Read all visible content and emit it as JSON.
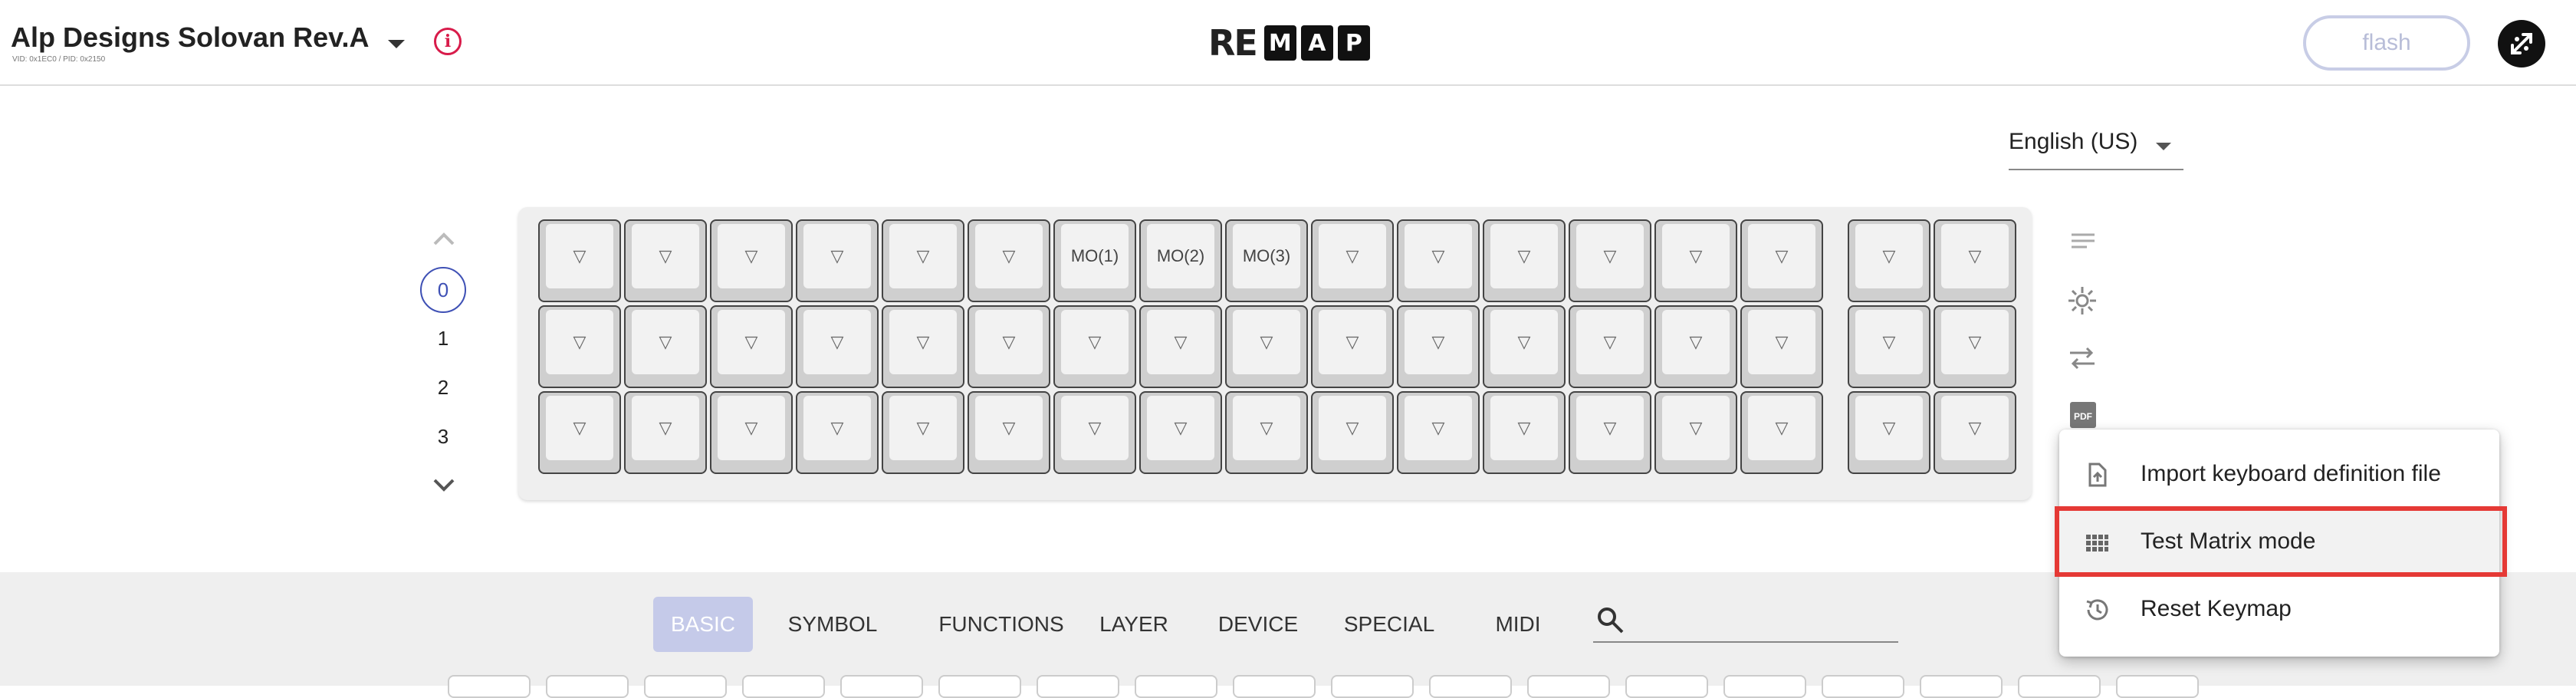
{
  "header": {
    "keyboard_name": "Alp Designs Solovan Rev.A",
    "vid_pid": "VID: 0x1EC0 / PID: 0x2150",
    "logo_prefix": "RE",
    "logo_boxes": [
      "M",
      "A",
      "P"
    ],
    "flash_label": "flash",
    "info_symbol": "i"
  },
  "language": {
    "selected": "English (US)"
  },
  "layers": {
    "items": [
      "0",
      "1",
      "2",
      "3"
    ],
    "active": "0"
  },
  "keymap": {
    "rows": [
      [
        "▽",
        "▽",
        "▽",
        "▽",
        "▽",
        "▽",
        "MO(1)",
        "MO(2)",
        "MO(3)",
        "▽",
        "▽",
        "▽",
        "▽",
        "▽",
        "▽",
        "▽",
        "▽"
      ],
      [
        "▽",
        "▽",
        "▽",
        "▽",
        "▽",
        "▽",
        "▽",
        "▽",
        "▽",
        "▽",
        "▽",
        "▽",
        "▽",
        "▽",
        "▽",
        "▽",
        "▽"
      ],
      [
        "▽",
        "▽",
        "▽",
        "▽",
        "▽",
        "▽",
        "▽",
        "▽",
        "▽",
        "▽",
        "▽",
        "▽",
        "▽",
        "▽",
        "▽",
        "▽",
        "▽"
      ]
    ]
  },
  "toolbar": {
    "icons": [
      "lines-icon",
      "brightness-icon",
      "swap-icon",
      "pdf-icon"
    ],
    "pdf_text": "PDF"
  },
  "menu": {
    "items": [
      {
        "label": "Import keyboard definition file",
        "icon": "file-upload-icon"
      },
      {
        "label": "Test Matrix mode",
        "icon": "grid-icon"
      },
      {
        "label": "Reset Keymap",
        "icon": "history-icon"
      }
    ],
    "highlighted": "Test Matrix mode",
    "highlight_color": "#e53935"
  },
  "categories": {
    "items": [
      "BASIC",
      "SYMBOL",
      "FUNCTIONS",
      "LAYER",
      "DEVICE",
      "SPECIAL",
      "MIDI"
    ],
    "active": "BASIC"
  },
  "search": {
    "placeholder": ""
  },
  "colors": {
    "accent": "#3f51b5",
    "info": "#d81b4a",
    "active_tab_bg": "#c5cae9"
  }
}
